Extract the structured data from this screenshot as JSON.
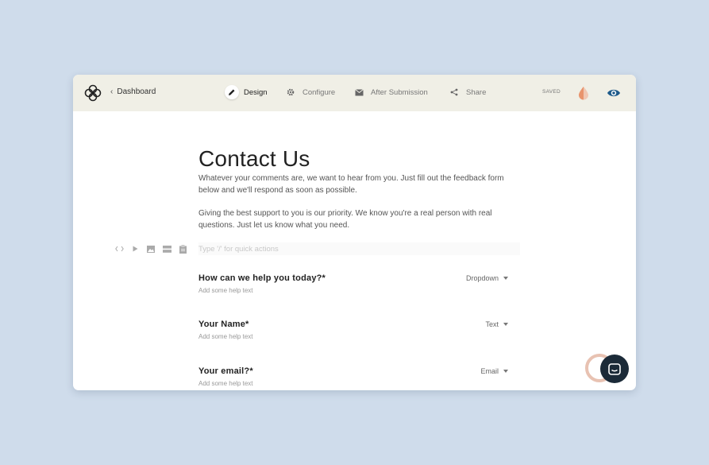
{
  "topbar": {
    "back_label": "Dashboard",
    "nav": [
      {
        "label": "Design",
        "icon": "pencil-icon",
        "active": true
      },
      {
        "label": "Configure",
        "icon": "gear-icon",
        "active": false
      },
      {
        "label": "After Submission",
        "icon": "envelope-icon",
        "active": false
      },
      {
        "label": "Share",
        "icon": "share-icon",
        "active": false
      }
    ],
    "status": "SAVED",
    "colors": {
      "bar_bg": "#f0efe6",
      "drop": "#e8a98e",
      "eye": "#1d5a8a"
    }
  },
  "form": {
    "title": "Contact Us",
    "intro_1": "Whatever your comments are, we want to hear from you. Just fill out the feedback form below and we'll respond as soon as possible.",
    "intro_2": "Giving the best support to you is our priority. We know you're a real person with real questions. Just let us know what you need.",
    "quick_placeholder": "Type '/' for quick actions",
    "fields": [
      {
        "label": "How can we help you today?*",
        "help": "Add some help text",
        "type": "Dropdown"
      },
      {
        "label": "Your Name*",
        "help": "Add some help text",
        "type": "Text"
      },
      {
        "label": "Your email?*",
        "help": "Add some help text",
        "type": "Email"
      }
    ]
  }
}
